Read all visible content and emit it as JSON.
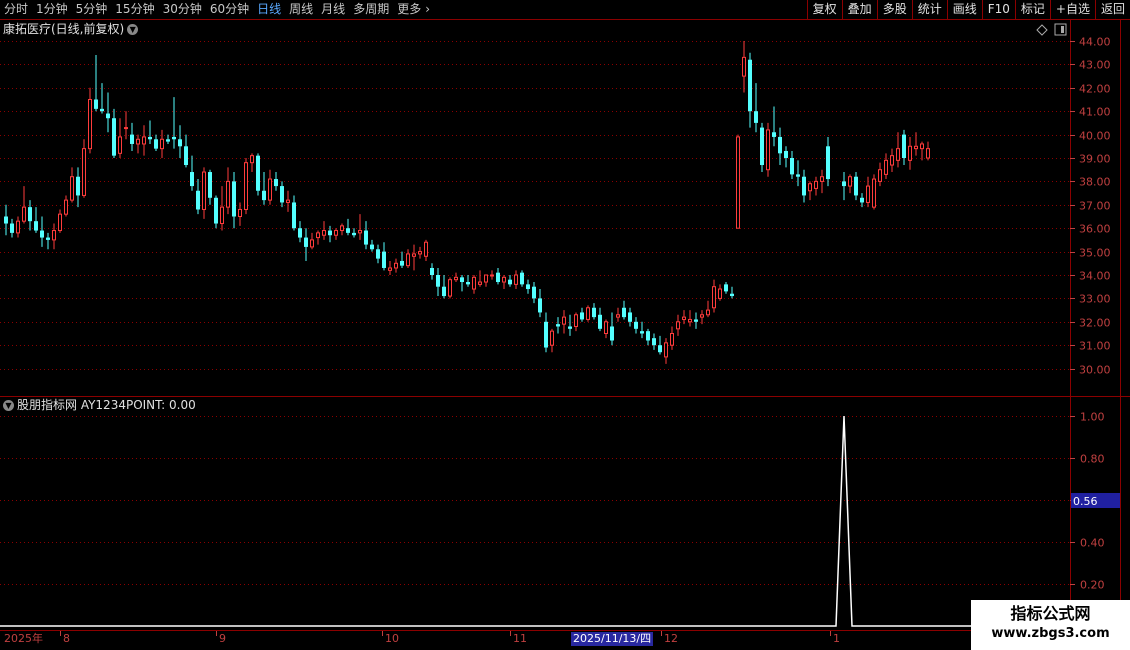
{
  "toolbar": {
    "periods": [
      {
        "label": "分时",
        "active": false
      },
      {
        "label": "1分钟",
        "active": false
      },
      {
        "label": "5分钟",
        "active": false
      },
      {
        "label": "15分钟",
        "active": false
      },
      {
        "label": "30分钟",
        "active": false
      },
      {
        "label": "60分钟",
        "active": false
      },
      {
        "label": "日线",
        "active": true
      },
      {
        "label": "周线",
        "active": false
      },
      {
        "label": "月线",
        "active": false
      },
      {
        "label": "多周期",
        "active": false
      },
      {
        "label": "更多",
        "active": false
      }
    ],
    "buttons": [
      "复权",
      "叠加",
      "多股",
      "统计",
      "画线",
      "F10",
      "标记",
      "+自选",
      "返回"
    ]
  },
  "chart": {
    "title": "康拓医疗(日线,前复权)",
    "price_ticks": [
      "44.00",
      "43.00",
      "42.00",
      "41.00",
      "40.00",
      "39.00",
      "38.00",
      "37.00",
      "36.00",
      "35.00",
      "34.00",
      "33.00",
      "32.00",
      "31.00",
      "30.00"
    ]
  },
  "indicator": {
    "title": "股朋指标网 AY1234POINT: 0.00",
    "ticks": [
      "1.00",
      "0.80",
      "0.40",
      "0.20"
    ],
    "current_value": "0.56"
  },
  "date_axis": {
    "labels": [
      "2025年",
      "8",
      "9",
      "10",
      "11",
      "12",
      "1"
    ],
    "selected": "2025/11/13/四"
  },
  "watermark": {
    "line1": "指标公式网",
    "line2": "www.zbgs3.com"
  },
  "colors": {
    "up": "#ff3c3c",
    "down": "#54ffff",
    "grid": "#8b0000",
    "axis": "#c04040",
    "indicator_line": "#ffffff"
  },
  "chart_data": {
    "type": "candlestick",
    "candles": [
      [
        36.5,
        37.0,
        35.7,
        36.2
      ],
      [
        36.2,
        36.4,
        35.6,
        35.8
      ],
      [
        35.8,
        36.5,
        35.6,
        36.3
      ],
      [
        36.3,
        37.8,
        36.2,
        36.9
      ],
      [
        36.9,
        37.2,
        35.9,
        36.3
      ],
      [
        36.3,
        36.9,
        35.8,
        35.9
      ],
      [
        35.9,
        36.5,
        35.2,
        35.6
      ],
      [
        35.6,
        35.8,
        35.1,
        35.5
      ],
      [
        35.5,
        36.2,
        35.1,
        35.9
      ],
      [
        35.9,
        36.8,
        35.8,
        36.6
      ],
      [
        36.6,
        37.4,
        36.5,
        37.2
      ],
      [
        37.2,
        38.6,
        37.1,
        38.2
      ],
      [
        38.2,
        38.6,
        36.9,
        37.4
      ],
      [
        37.4,
        39.8,
        37.3,
        39.4
      ],
      [
        39.4,
        42.0,
        39.2,
        41.5
      ],
      [
        41.5,
        43.4,
        41.0,
        41.1
      ],
      [
        41.1,
        42.2,
        40.9,
        41.0
      ],
      [
        40.9,
        41.8,
        40.1,
        40.7
      ],
      [
        40.7,
        41.1,
        39.0,
        39.1
      ],
      [
        39.2,
        40.7,
        39.0,
        39.9
      ],
      [
        40.3,
        41.0,
        39.8,
        40.3
      ],
      [
        40.0,
        40.5,
        39.3,
        39.6
      ],
      [
        39.6,
        40.0,
        39.2,
        39.8
      ],
      [
        39.6,
        40.4,
        39.1,
        39.9
      ],
      [
        39.9,
        40.6,
        39.6,
        39.8
      ],
      [
        39.8,
        40.0,
        39.3,
        39.4
      ],
      [
        39.4,
        40.2,
        39.0,
        39.8
      ],
      [
        39.8,
        40.0,
        39.6,
        39.7
      ],
      [
        39.9,
        41.6,
        39.4,
        39.8
      ],
      [
        39.8,
        40.4,
        39.0,
        39.5
      ],
      [
        39.5,
        40.0,
        38.6,
        38.7
      ],
      [
        38.4,
        39.1,
        37.6,
        37.8
      ],
      [
        37.6,
        38.1,
        36.6,
        36.8
      ],
      [
        36.8,
        38.6,
        36.4,
        38.4
      ],
      [
        38.4,
        38.5,
        37.0,
        37.3
      ],
      [
        37.3,
        37.4,
        36.0,
        36.2
      ],
      [
        36.2,
        37.8,
        35.9,
        36.9
      ],
      [
        36.9,
        38.6,
        36.6,
        38.0
      ],
      [
        38.0,
        38.4,
        36.0,
        36.5
      ],
      [
        36.5,
        37.1,
        36.1,
        36.8
      ],
      [
        36.8,
        39.0,
        36.6,
        38.8
      ],
      [
        38.8,
        39.2,
        38.4,
        39.1
      ],
      [
        39.1,
        39.2,
        37.4,
        37.6
      ],
      [
        37.6,
        38.4,
        37.0,
        37.2
      ],
      [
        37.2,
        38.5,
        37.0,
        38.1
      ],
      [
        38.1,
        38.4,
        37.6,
        37.8
      ],
      [
        37.8,
        38.0,
        36.9,
        37.1
      ],
      [
        37.1,
        37.6,
        36.7,
        37.2
      ],
      [
        37.1,
        37.4,
        35.9,
        36.0
      ],
      [
        36.0,
        36.3,
        35.4,
        35.6
      ],
      [
        35.6,
        36.0,
        34.6,
        35.2
      ],
      [
        35.2,
        35.8,
        35.1,
        35.5
      ],
      [
        35.6,
        35.9,
        35.3,
        35.8
      ],
      [
        35.7,
        36.3,
        35.5,
        35.9
      ],
      [
        35.9,
        36.1,
        35.4,
        35.7
      ],
      [
        35.7,
        36.0,
        35.5,
        35.9
      ],
      [
        35.9,
        36.2,
        35.7,
        36.1
      ],
      [
        36.0,
        36.4,
        35.7,
        35.8
      ],
      [
        35.8,
        36.0,
        35.6,
        35.7
      ],
      [
        35.8,
        36.6,
        35.5,
        35.9
      ],
      [
        35.9,
        36.3,
        35.1,
        35.3
      ],
      [
        35.3,
        35.5,
        35.0,
        35.1
      ],
      [
        35.1,
        35.3,
        34.5,
        34.7
      ],
      [
        35.0,
        35.4,
        34.2,
        34.3
      ],
      [
        34.2,
        34.6,
        34.0,
        34.3
      ],
      [
        34.3,
        34.7,
        34.1,
        34.5
      ],
      [
        34.6,
        35.0,
        34.3,
        34.4
      ],
      [
        34.4,
        35.1,
        34.3,
        34.9
      ],
      [
        34.8,
        35.3,
        34.2,
        34.9
      ],
      [
        34.9,
        35.2,
        34.7,
        35.0
      ],
      [
        34.8,
        35.5,
        34.6,
        35.4
      ],
      [
        34.3,
        34.5,
        33.8,
        34.0
      ],
      [
        34.0,
        34.3,
        33.1,
        33.5
      ],
      [
        33.5,
        34.0,
        33.0,
        33.1
      ],
      [
        33.1,
        33.9,
        33.0,
        33.8
      ],
      [
        33.8,
        34.1,
        33.7,
        33.9
      ],
      [
        33.9,
        34.0,
        33.3,
        33.7
      ],
      [
        33.7,
        34.0,
        33.5,
        33.6
      ],
      [
        33.4,
        34.0,
        33.2,
        33.9
      ],
      [
        33.6,
        34.2,
        33.5,
        33.7
      ],
      [
        33.7,
        34.0,
        33.5,
        34.0
      ],
      [
        34.0,
        34.2,
        33.8,
        34.0
      ],
      [
        34.1,
        34.3,
        33.6,
        33.7
      ],
      [
        33.7,
        34.0,
        33.4,
        33.9
      ],
      [
        33.8,
        34.0,
        33.5,
        33.6
      ],
      [
        33.6,
        34.2,
        33.4,
        34.0
      ],
      [
        34.1,
        34.2,
        33.5,
        33.6
      ],
      [
        33.6,
        33.8,
        33.2,
        33.4
      ],
      [
        33.5,
        33.7,
        32.8,
        33.0
      ],
      [
        33.0,
        33.4,
        32.2,
        32.4
      ],
      [
        32.0,
        32.4,
        30.7,
        30.9
      ],
      [
        31.0,
        31.7,
        30.7,
        31.6
      ],
      [
        31.9,
        32.2,
        31.5,
        31.8
      ],
      [
        31.9,
        32.5,
        31.5,
        32.2
      ],
      [
        31.8,
        32.3,
        31.4,
        31.7
      ],
      [
        31.8,
        32.4,
        31.6,
        32.3
      ],
      [
        32.4,
        32.6,
        32.0,
        32.1
      ],
      [
        32.1,
        32.7,
        32.0,
        32.6
      ],
      [
        32.6,
        32.8,
        32.1,
        32.2
      ],
      [
        32.3,
        32.6,
        31.6,
        31.7
      ],
      [
        31.5,
        32.1,
        31.3,
        32.0
      ],
      [
        31.8,
        32.4,
        31.0,
        31.2
      ],
      [
        32.2,
        32.6,
        32.0,
        32.3
      ],
      [
        32.6,
        32.9,
        32.1,
        32.2
      ],
      [
        32.4,
        32.6,
        31.8,
        32.0
      ],
      [
        32.0,
        32.2,
        31.5,
        31.7
      ],
      [
        31.6,
        32.0,
        31.3,
        31.5
      ],
      [
        31.6,
        31.7,
        31.0,
        31.2
      ],
      [
        31.3,
        31.5,
        30.8,
        31.0
      ],
      [
        31.0,
        31.4,
        30.6,
        30.7
      ],
      [
        30.5,
        31.3,
        30.2,
        31.1
      ],
      [
        31.0,
        31.8,
        30.8,
        31.5
      ],
      [
        31.7,
        32.3,
        31.4,
        32.0
      ],
      [
        32.1,
        32.5,
        31.9,
        32.2
      ],
      [
        32.0,
        32.5,
        31.8,
        32.1
      ],
      [
        32.1,
        32.4,
        31.7,
        32.0
      ],
      [
        32.2,
        32.5,
        31.9,
        32.3
      ],
      [
        32.3,
        32.9,
        32.2,
        32.5
      ],
      [
        32.6,
        33.8,
        32.4,
        33.5
      ],
      [
        33.0,
        33.6,
        32.9,
        33.4
      ],
      [
        33.6,
        33.7,
        33.2,
        33.3
      ],
      [
        33.2,
        33.5,
        33.0,
        33.1
      ],
      [
        36.0,
        40.0,
        36.0,
        39.9
      ],
      [
        42.5,
        44.0,
        41.8,
        43.3
      ],
      [
        43.2,
        43.5,
        40.3,
        41.0
      ],
      [
        41.0,
        42.2,
        40.1,
        40.5
      ],
      [
        40.3,
        40.5,
        38.4,
        38.7
      ],
      [
        38.5,
        40.5,
        38.2,
        40.2
      ],
      [
        40.1,
        41.2,
        39.5,
        39.9
      ],
      [
        39.9,
        40.3,
        38.7,
        39.2
      ],
      [
        39.3,
        39.5,
        38.6,
        39.0
      ],
      [
        39.0,
        39.3,
        38.1,
        38.3
      ],
      [
        38.3,
        38.9,
        37.8,
        38.2
      ],
      [
        38.2,
        38.5,
        37.1,
        37.4
      ],
      [
        37.6,
        38.0,
        37.2,
        37.9
      ],
      [
        37.7,
        38.2,
        37.4,
        38.0
      ],
      [
        38.0,
        38.5,
        37.5,
        38.2
      ],
      [
        39.5,
        39.9,
        37.8,
        38.1
      ],
      [
        38.0,
        38.4,
        37.2,
        37.8
      ],
      [
        37.8,
        38.3,
        37.5,
        38.2
      ],
      [
        38.2,
        38.4,
        37.2,
        37.4
      ],
      [
        37.3,
        37.5,
        36.9,
        37.1
      ],
      [
        37.1,
        38.2,
        36.9,
        37.8
      ],
      [
        36.9,
        38.3,
        36.8,
        38.1
      ],
      [
        38.0,
        38.8,
        37.8,
        38.5
      ],
      [
        38.3,
        39.2,
        38.1,
        38.9
      ],
      [
        38.7,
        39.4,
        38.4,
        39.1
      ],
      [
        38.9,
        40.1,
        38.6,
        39.4
      ],
      [
        40.0,
        40.2,
        38.7,
        39.0
      ],
      [
        38.9,
        39.9,
        38.5,
        39.5
      ],
      [
        39.4,
        40.1,
        39.1,
        39.5
      ],
      [
        39.4,
        39.7,
        38.9,
        39.6
      ],
      [
        39.0,
        39.7,
        38.9,
        39.4
      ]
    ],
    "indicator": {
      "name": "AY1234POINT",
      "spike_value": 1.0,
      "baseline": 0.0
    }
  }
}
